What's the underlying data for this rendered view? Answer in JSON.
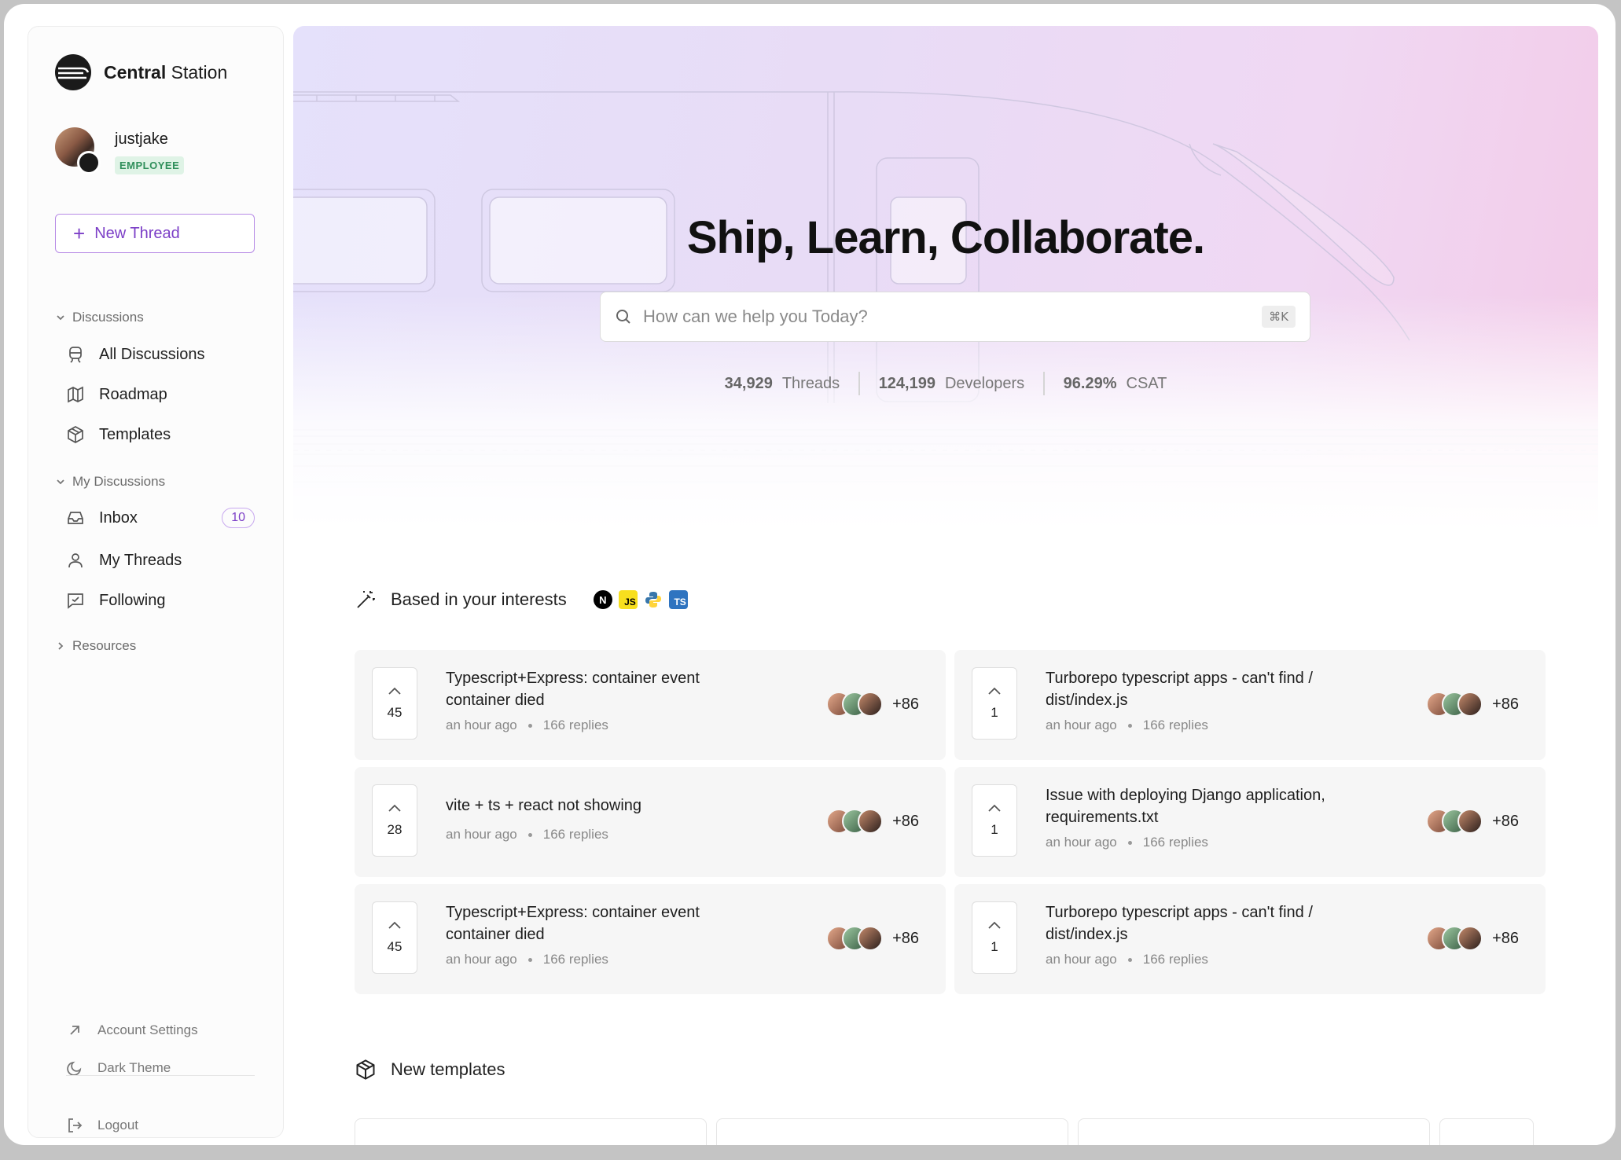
{
  "brand": {
    "name_bold": "Central",
    "name_rest": "Station"
  },
  "user": {
    "name": "justjake",
    "role_badge": "EMPLOYEE"
  },
  "new_thread_label": "New Thread",
  "sidebar": {
    "discussions_header": "Discussions",
    "discussions_items": [
      {
        "label": "All Discussions",
        "icon": "discussions-icon"
      },
      {
        "label": "Roadmap",
        "icon": "map-icon"
      },
      {
        "label": "Templates",
        "icon": "package-icon"
      }
    ],
    "my_discussions_header": "My Discussions",
    "my_items": [
      {
        "label": "Inbox",
        "icon": "inbox-icon",
        "badge": "10"
      },
      {
        "label": "My Threads",
        "icon": "user-icon"
      },
      {
        "label": "Following",
        "icon": "following-icon"
      }
    ],
    "resources_header": "Resources",
    "bottom": {
      "account_settings": "Account Settings",
      "dark_theme": "Dark Theme",
      "logout": "Logout"
    }
  },
  "hero": {
    "title": "Ship, Learn, Collaborate.",
    "search_placeholder": "How can we help you Today?",
    "shortcut": "⌘K",
    "stats": [
      {
        "value": "34,929",
        "label": "Threads"
      },
      {
        "value": "124,199",
        "label": "Developers"
      },
      {
        "value": "96.29%",
        "label": "CSAT"
      }
    ]
  },
  "interests": {
    "title": "Based in your interests",
    "tech_icons": [
      "nextjs-icon",
      "javascript-icon",
      "python-icon",
      "typescript-icon"
    ],
    "tech_labels": {
      "nextjs": "N",
      "js": "JS",
      "ts": "TS"
    }
  },
  "threads": [
    {
      "votes": "45",
      "title": "Typescript+Express: container event container died",
      "time": "an hour ago",
      "replies": "166 replies",
      "more": "+86"
    },
    {
      "votes": "1",
      "title": "Turborepo typescript apps - can't find / dist/index.js",
      "time": "an hour ago",
      "replies": "166 replies",
      "more": "+86"
    },
    {
      "votes": "28",
      "title": "vite + ts + react not showing",
      "time": "an hour ago",
      "replies": "166 replies",
      "more": "+86"
    },
    {
      "votes": "1",
      "title": "Issue with deploying Django application, requirements.txt",
      "time": "an hour ago",
      "replies": "166 replies",
      "more": "+86"
    },
    {
      "votes": "45",
      "title": "Typescript+Express: container event container died",
      "time": "an hour ago",
      "replies": "166 replies",
      "more": "+86"
    },
    {
      "votes": "1",
      "title": "Turborepo typescript apps - can't find / dist/index.js",
      "time": "an hour ago",
      "replies": "166 replies",
      "more": "+86"
    }
  ],
  "new_templates": {
    "title": "New templates"
  },
  "colors": {
    "accent": "#7c3fc7",
    "badge_green": "#2f8f5b"
  }
}
